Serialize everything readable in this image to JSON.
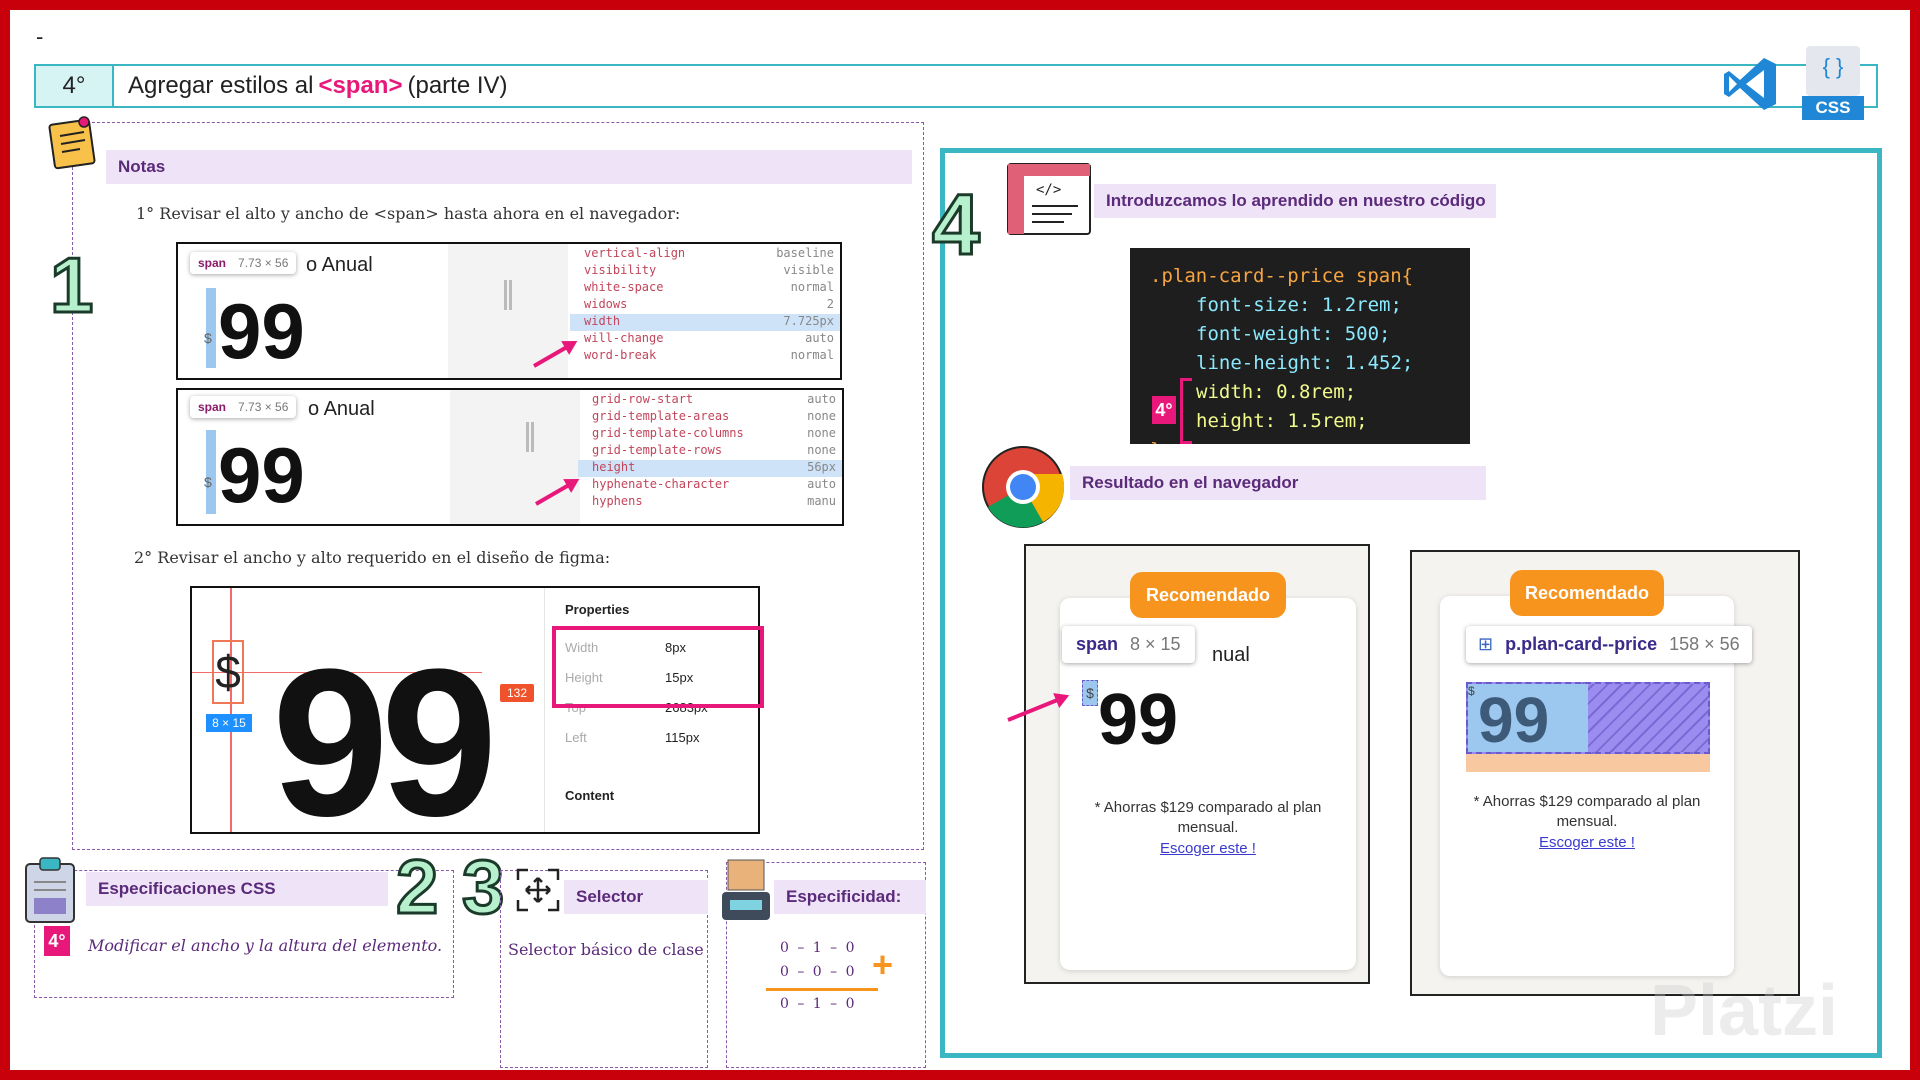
{
  "header": {
    "dash": "-",
    "number": "4°",
    "title_pre": "Agregar estilos al",
    "title_tag": "<span>",
    "title_post": "(parte IV)",
    "vscode_icon": "vscode-icon",
    "css_icon": "css-file-icon",
    "css_label": "CSS",
    "braces": "{ }"
  },
  "notes": {
    "title": "Notas",
    "step1": "1° Revisar el alto y ancho de <span> hasta ahora en el navegador:",
    "step2": "2° Revisar el ancho y alto requerido en el diseño de figma:",
    "big1": "1"
  },
  "devtools1": {
    "tag": "span",
    "size": "7.73 × 56",
    "anual": "o Anual",
    "dollar": "$",
    "nine": "99",
    "rows": [
      [
        "vertical-align",
        "baseline"
      ],
      [
        "visibility",
        "visible"
      ],
      [
        "white-space",
        "normal"
      ],
      [
        "widows",
        "2"
      ],
      [
        "width",
        "7.725px"
      ],
      [
        "will-change",
        "auto"
      ],
      [
        "word-break",
        "normal"
      ]
    ],
    "highlight": 4
  },
  "devtools2": {
    "tag": "span",
    "size": "7.73 × 56",
    "anual": "o Anual",
    "dollar": "$",
    "nine": "99",
    "rows": [
      [
        "grid-row-start",
        "auto"
      ],
      [
        "grid-template-areas",
        "none"
      ],
      [
        "grid-template-columns",
        "none"
      ],
      [
        "grid-template-rows",
        "none"
      ],
      [
        "height",
        "56px"
      ],
      [
        "hyphenate-character",
        "auto"
      ],
      [
        "hyphens",
        "manu"
      ]
    ],
    "highlight": 4
  },
  "figma": {
    "dollar": "$",
    "size_badge": "8 × 15",
    "nine": "99",
    "red_badge": "132",
    "properties_title": "Properties",
    "props": [
      [
        "Width",
        "8px"
      ],
      [
        "Height",
        "15px"
      ],
      [
        "Top",
        "2683px"
      ],
      [
        "Left",
        "115px"
      ]
    ],
    "content_label": "Content"
  },
  "specs": {
    "title": "Especificaciones CSS",
    "text": "Modificar el ancho y la altura del elemento.",
    "badge": "4°"
  },
  "selector": {
    "big2": "2",
    "big3": "3",
    "title": "Selector",
    "text": "Selector básico de clase"
  },
  "specificity": {
    "title": "Especificidad:",
    "line1": "0 – 1 – 0",
    "line2": "0 – 0 – 0",
    "line3": "0 – 1 – 0",
    "plus": "+"
  },
  "right": {
    "big4": "4",
    "code_head": "Introduzcamos lo aprendido en nuestro código",
    "result_head": "Resultado en el navegador",
    "code": [
      ".plan-card--price span{",
      "font-size: 1.2rem;",
      "font-weight: 500;",
      "line-height: 1.452;",
      "width: 0.8rem;",
      "height: 1.5rem;",
      "}"
    ],
    "code_badge": "4°"
  },
  "result1": {
    "badge": "Recomendado",
    "tag": "span",
    "size": "8 × 15",
    "anual": "nual",
    "dollar": "$",
    "nine": "99",
    "note": "* Ahorras $129 comparado al plan mensual.",
    "link": "Escoger este !"
  },
  "result2": {
    "badge": "Recomendado",
    "selector": "p.plan-card--price",
    "size": "158 × 56",
    "dollar": "$",
    "nine": "99",
    "note": "* Ahorras $129 comparado al plan mensual.",
    "link": "Escoger este !"
  },
  "watermark": "Platzi",
  "colors": {
    "frame": "#c8000c",
    "teal": "#3bb6c3",
    "pink": "#e8177a",
    "orange": "#f7941d",
    "purple": "#5b2a7a"
  }
}
